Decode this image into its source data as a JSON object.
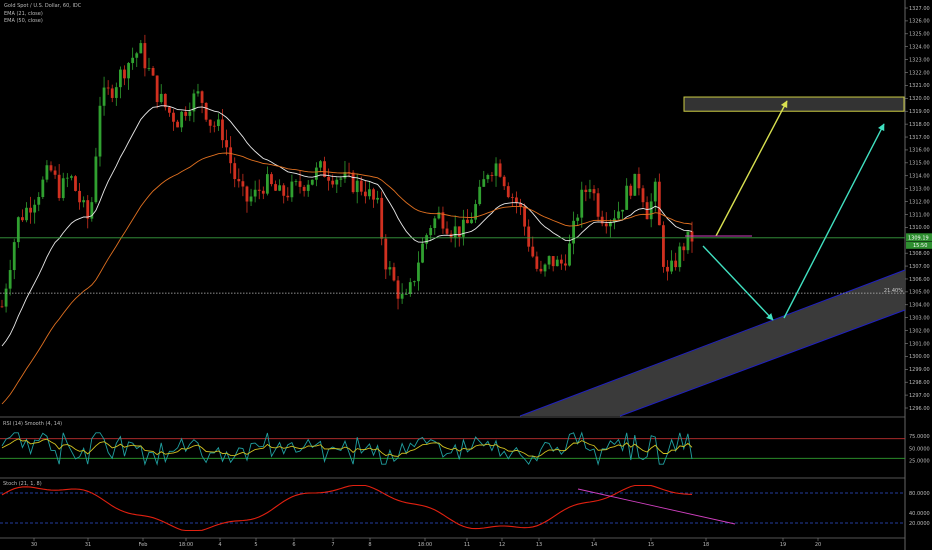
{
  "chart_data": {
    "type": "candlestick",
    "title": "Gold Spot / U.S. Dollar, 60, IDC",
    "indicators": [
      "EMA (21, close)",
      "EMA (50, close)"
    ],
    "price_axis": {
      "ylim": [
        1295,
        1328
      ],
      "ticks": [
        "1327.00",
        "1326.00",
        "1325.00",
        "1324.00",
        "1323.00",
        "1322.00",
        "1321.00",
        "1320.00",
        "1319.00",
        "1318.00",
        "1317.00",
        "1316.00",
        "1315.00",
        "1314.00",
        "1313.00",
        "1312.00",
        "1311.00",
        "1310.00",
        "1308.00",
        "1307.00",
        "1306.00",
        "1305.00",
        "1304.00",
        "1303.00",
        "1302.00",
        "1301.00",
        "1300.00",
        "1299.00",
        "1298.00",
        "1297.00",
        "1296.00"
      ]
    },
    "current_price_label": "1309.19",
    "current_price_sub": "15:50",
    "current_price": 1309.19,
    "fib_label": "21.40%",
    "fib_level": 1304.9,
    "x_labels": [
      "30",
      "31",
      "Feb",
      "18:00",
      "4",
      "5",
      "6",
      "7",
      "8",
      "18:00",
      "11",
      "12",
      "13",
      "14",
      "15",
      "18",
      "19",
      "20"
    ],
    "series_colors": {
      "up": "#30a030",
      "down": "#d03020",
      "ema21": "#e8e8e8",
      "ema50": "#e07020"
    },
    "target_zone": {
      "from": 1319.0,
      "to": 1320.1,
      "color": "#cccc44"
    },
    "channel": {
      "color": "#2020c0"
    },
    "rsi": {
      "label": "RSI (14) Smooth (4, 14)",
      "ylim": [
        0,
        100
      ],
      "ticks": [
        "75.0000",
        "50.0000",
        "25.0000"
      ],
      "levels": [
        70,
        30
      ],
      "colors": {
        "fast": "#20a0a0",
        "slow": "#d0c020"
      }
    },
    "stoch": {
      "label": "Stoch (21, 1, 8)",
      "ylim": [
        0,
        100
      ],
      "ticks": [
        "80.0000",
        "40.0000",
        "20.0000"
      ],
      "levels": [
        80,
        20
      ],
      "color": "#e02010"
    }
  }
}
